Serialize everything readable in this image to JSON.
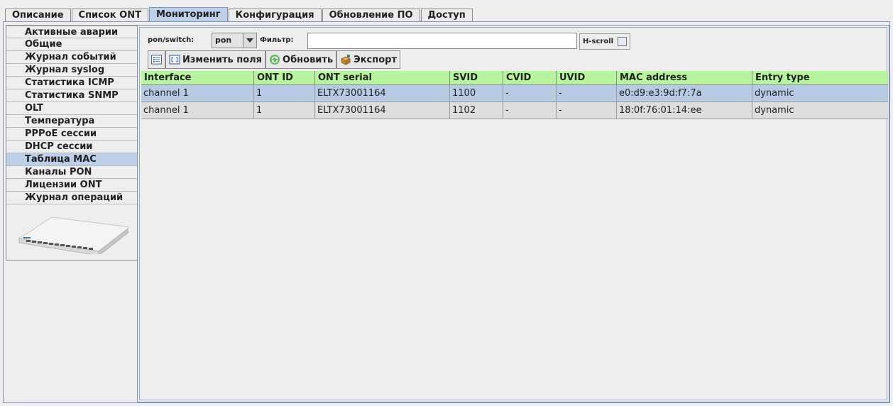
{
  "tabs": [
    "Описание",
    "Список ONT",
    "Мониторинг",
    "Конфигурация",
    "Обновление ПО",
    "Доступ"
  ],
  "active_tab_index": 2,
  "sidebar": {
    "items": [
      "Активные аварии",
      "Общие",
      "Журнал событий",
      "Журнал syslog",
      "Статистика ICMP",
      "Статистика SNMP",
      "OLT",
      "Температура",
      "PPPoE сессии",
      "DHCP сессии",
      "Таблица MAC",
      "Каналы PON",
      "Лицензии ONT",
      "Журнал операций"
    ],
    "active_index": 10
  },
  "filters": {
    "pon_switch_label": "pon/switch:",
    "pon_switch_value": "pon",
    "filter_label": "Фильтр:",
    "filter_value": "",
    "hscroll_label": "H-scroll",
    "hscroll_checked": false
  },
  "toolbar": {
    "edit_fields_label": "Изменить поля",
    "refresh_label": "Обновить",
    "export_label": "Экспорт"
  },
  "table": {
    "columns": [
      "Interface",
      "ONT ID",
      "ONT serial",
      "SVID",
      "CVID",
      "UVID",
      "MAC address",
      "Entry type"
    ],
    "rows": [
      [
        "channel 1",
        "1",
        "ELTX73001164",
        "1100",
        "-",
        "-",
        "e0:d9:e3:9d:f7:7a",
        "dynamic"
      ],
      [
        "channel 1",
        "1",
        "ELTX73001164",
        "1102",
        "-",
        "-",
        "18:0f:76:01:14:ee",
        "dynamic"
      ]
    ],
    "selected_row": 0
  },
  "colors": {
    "header_bg": "#b6f59d",
    "selected_bg": "#b8cbe4",
    "active_tab_bg": "#bcd0ea"
  }
}
